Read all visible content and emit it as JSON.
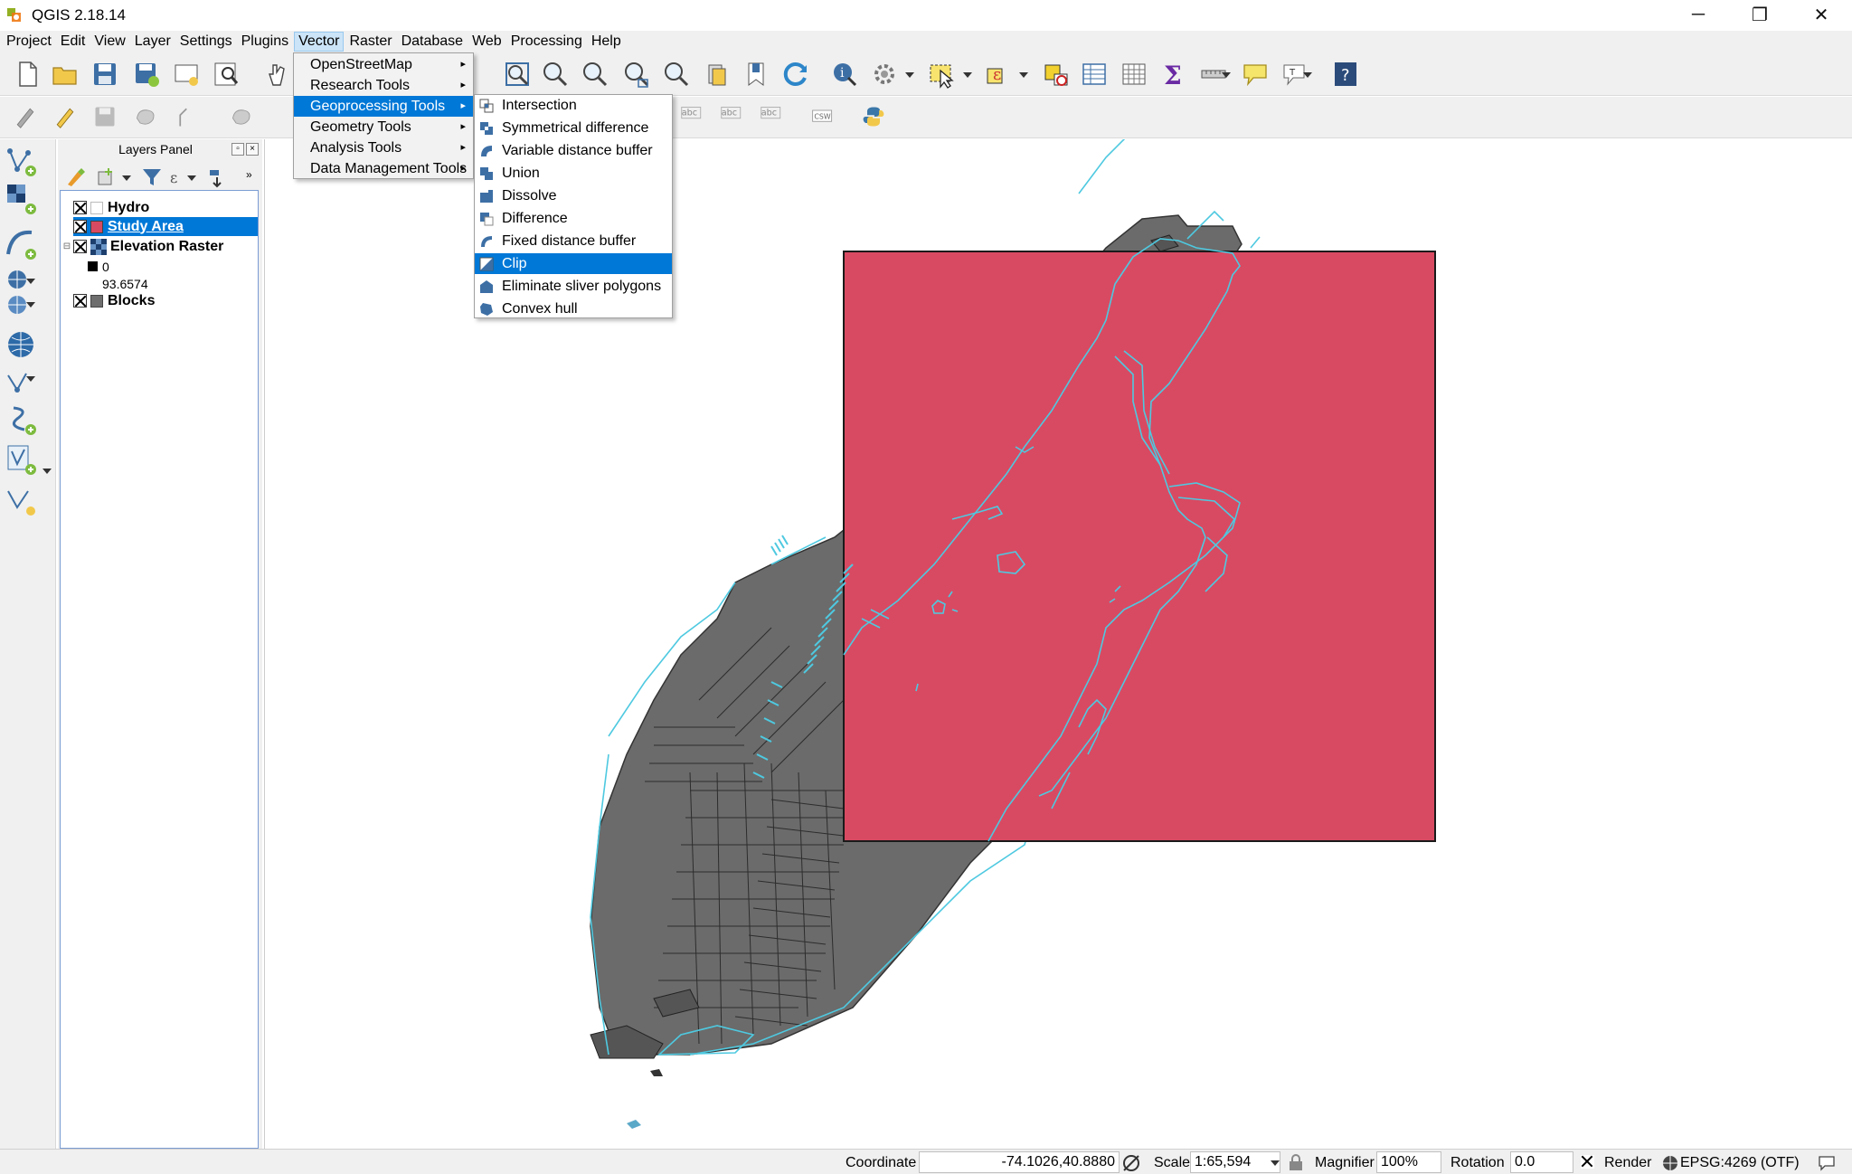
{
  "window": {
    "title": "QGIS 2.18.14",
    "minimize": "─",
    "restore": "❐",
    "close": "✕"
  },
  "menubar": [
    "Project",
    "Edit",
    "View",
    "Layer",
    "Settings",
    "Plugins",
    "Vector",
    "Raster",
    "Database",
    "Web",
    "Processing",
    "Help"
  ],
  "vector_menu": {
    "items": [
      "OpenStreetMap",
      "Research Tools",
      "Geoprocessing Tools",
      "Geometry Tools",
      "Analysis Tools",
      "Data Management Tools"
    ],
    "highlighted": "Geoprocessing Tools"
  },
  "geoprocessing_menu": {
    "items": [
      "Intersection",
      "Symmetrical difference",
      "Variable distance buffer",
      "Union",
      "Dissolve",
      "Difference",
      "Fixed distance buffer",
      "Clip",
      "Eliminate sliver polygons",
      "Convex hull"
    ],
    "highlighted": "Clip"
  },
  "layers_panel": {
    "title": "Layers Panel",
    "layers": [
      {
        "name": "Hydro",
        "checked": true,
        "color": "#ffffff"
      },
      {
        "name": "Study Area",
        "checked": true,
        "color": "#d84a62",
        "selected": true
      },
      {
        "name": "Elevation Raster",
        "checked": true,
        "color": "raster"
      },
      {
        "name": "Blocks",
        "checked": true,
        "color": "#6e6e6e"
      }
    ],
    "raster_legend": {
      "min": "0",
      "max": "93.6574"
    },
    "overflow": "»"
  },
  "toolbar2": {
    "label_csw": "CSW",
    "label_abc": "abc"
  },
  "statusbar": {
    "coordinate_label": "Coordinate",
    "coordinate_value": "-74.1026,40.8880",
    "scale_label": "Scale",
    "scale_value": "1:65,594",
    "magnifier_label": "Magnifier",
    "magnifier_value": "100%",
    "rotation_label": "Rotation",
    "rotation_value": "0.0",
    "render_label": "Render",
    "crs": "EPSG:4269 (OTF)"
  },
  "colors": {
    "study_area": "#d84a62",
    "blocks": "#6b6b6b",
    "hydro": "#4ec9e0",
    "selection": "#0078d7"
  }
}
